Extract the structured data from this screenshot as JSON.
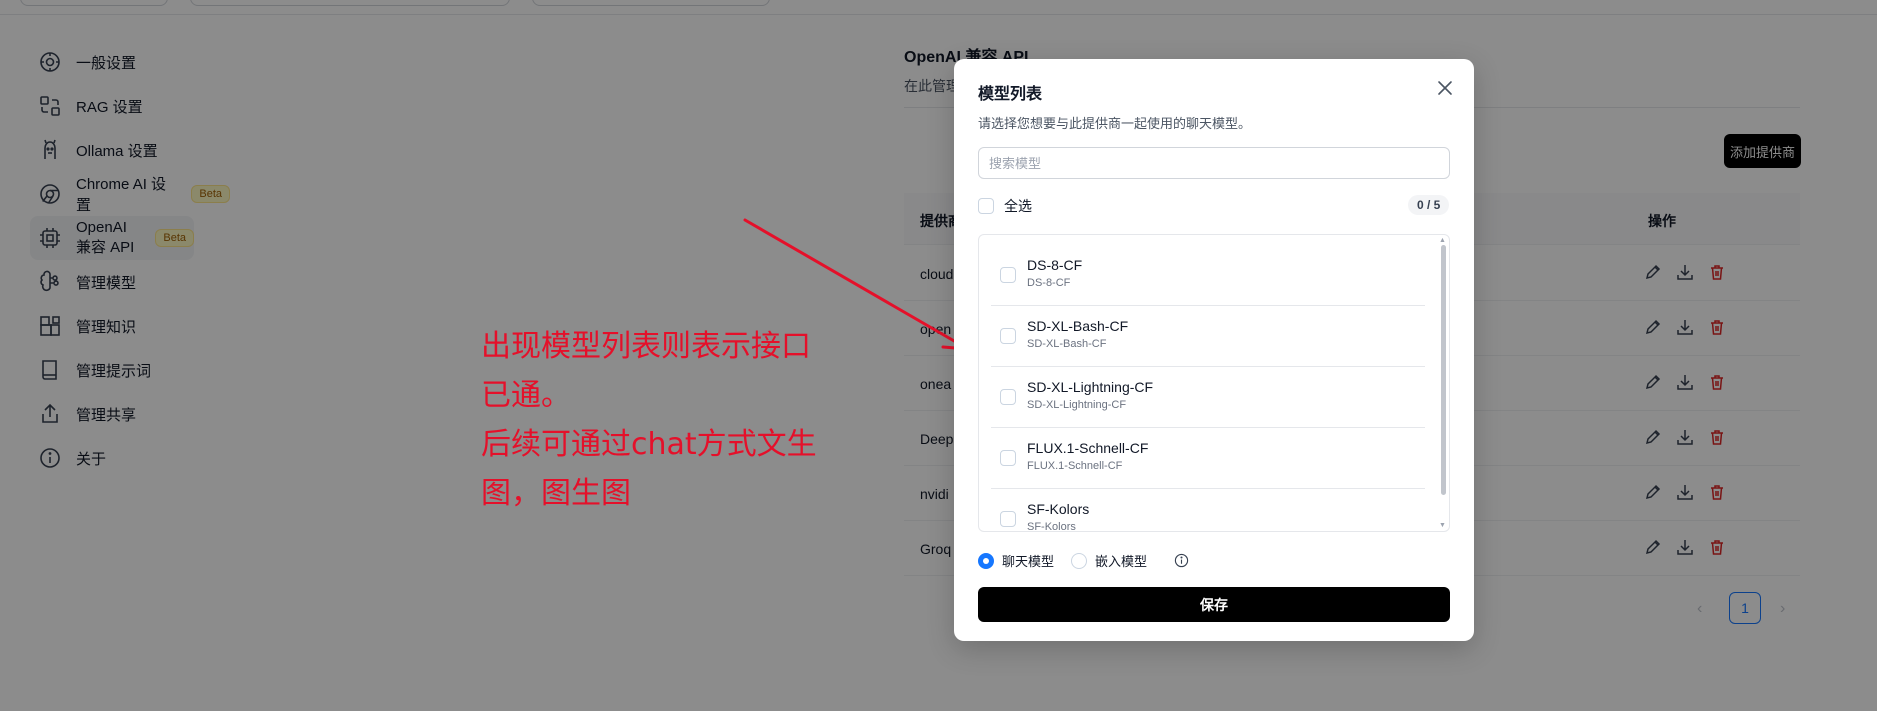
{
  "sidebar": {
    "items": [
      {
        "label": "一般设置",
        "icon": "gear-icon"
      },
      {
        "label": "RAG 设置",
        "icon": "rag-icon"
      },
      {
        "label": "Ollama 设置",
        "icon": "llama-icon"
      },
      {
        "label": "Chrome AI 设置",
        "icon": "chrome-icon",
        "badge": "Beta"
      },
      {
        "label": "OpenAI 兼容 API",
        "icon": "cpu-icon",
        "badge": "Beta",
        "active": true
      },
      {
        "label": "管理模型",
        "icon": "brain-icon"
      },
      {
        "label": "管理知识",
        "icon": "blocks-icon"
      },
      {
        "label": "管理提示词",
        "icon": "book-icon"
      },
      {
        "label": "管理共享",
        "icon": "share-icon"
      },
      {
        "label": "关于",
        "icon": "info-icon"
      }
    ]
  },
  "main": {
    "title": "OpenAI 兼容 API",
    "subtitle": "在此管理",
    "add_provider": "添加提供商",
    "table": {
      "col_provider": "提供商",
      "col_actions": "操作",
      "rows": [
        "cloud",
        "open",
        "onea",
        "Deep",
        "nvidi",
        "Groq"
      ]
    },
    "pagination": {
      "current": "1",
      "prev": "‹",
      "next": "›"
    }
  },
  "annotation": {
    "line1": "出现模型列表则表示接口",
    "line2": "已通。",
    "line3": "后续可通过chat方式文生",
    "line4": "图，图生图"
  },
  "modal": {
    "title": "模型列表",
    "description": "请选择您想要与此提供商一起使用的聊天模型。",
    "search_placeholder": "搜索模型",
    "select_all": "全选",
    "count": "0 / 5",
    "models": [
      {
        "name": "DS-8-CF",
        "id": "DS-8-CF"
      },
      {
        "name": "SD-XL-Bash-CF",
        "id": "SD-XL-Bash-CF"
      },
      {
        "name": "SD-XL-Lightning-CF",
        "id": "SD-XL-Lightning-CF"
      },
      {
        "name": "FLUX.1-Schnell-CF",
        "id": "FLUX.1-Schnell-CF"
      },
      {
        "name": "SF-Kolors",
        "id": "SF-Kolors"
      }
    ],
    "model_type": {
      "chat": "聊天模型",
      "embedding": "嵌入模型",
      "selected": "chat"
    },
    "save": "保存"
  },
  "colors": {
    "accent": "#1677ff",
    "annotation": "#e5102a",
    "danger": "#dc2626"
  }
}
